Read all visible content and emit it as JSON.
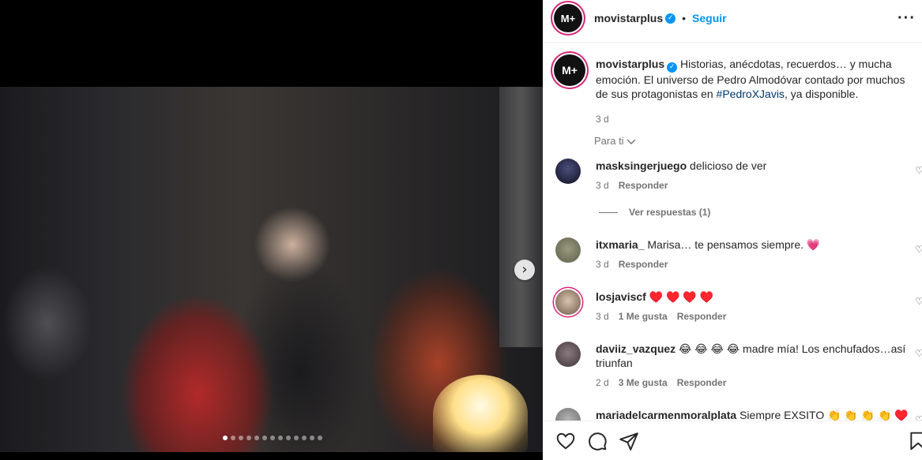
{
  "post": {
    "account": "movistarplus",
    "avatar_text": "M+",
    "follow_label": "Seguir",
    "separator": "•",
    "more_label": "···",
    "caption": "Historias, anécdotas, recuerdos… y mucha emoción. El universo de Pedro Almodóvar contado por muchos de sus protagonistas en ",
    "hashtag": "#PedroXJavis",
    "caption_end": ", ya disponible.",
    "caption_time": "3 d",
    "sort_label": "Para ti",
    "carousel": {
      "dots": 13,
      "active_index": 0
    },
    "colors": {
      "accent": "#0095f6",
      "story_ring": "#d62976",
      "hashtag": "#00376b"
    }
  },
  "comments": [
    {
      "user": "masksingerjuego",
      "text": "delicioso de ver",
      "time": "3 d",
      "likes": "",
      "reply": "Responder",
      "view_replies": "Ver respuestas (1)"
    },
    {
      "user": "itxmaria_",
      "text": "Marisa… te pensamos siempre. 💗",
      "time": "3 d",
      "likes": "",
      "reply": "Responder"
    },
    {
      "user": "losjaviscf",
      "text": "♥️ ♥️ ♥️ ♥️",
      "time": "3 d",
      "likes": "1 Me gusta",
      "reply": "Responder"
    },
    {
      "user": "daviiz_vazquez",
      "text": "😂 😂 😂 😂 madre mía! Los enchufados…así triunfan",
      "time": "2 d",
      "likes": "3 Me gusta",
      "reply": "Responder"
    },
    {
      "user": "mariadelcarmenmoralplata",
      "text": "Siempre EXSITO 👏 👏 👏 👏 ♥️"
    }
  ]
}
